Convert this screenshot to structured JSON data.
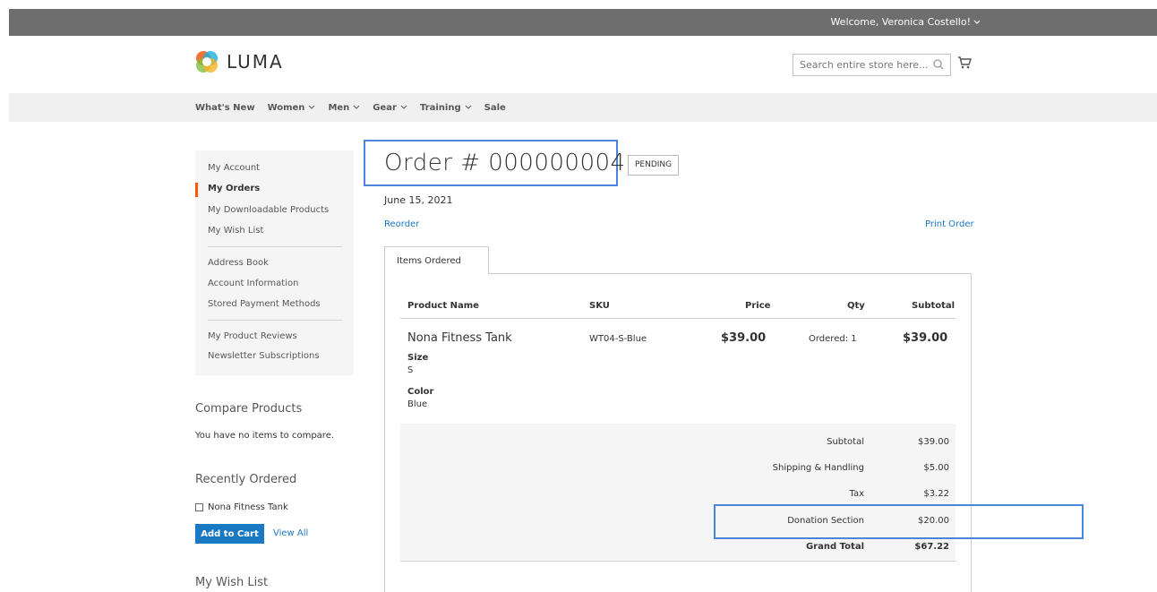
{
  "header": {
    "welcome": "Welcome, Veronica Costello!",
    "logo": "LUMA",
    "search_placeholder": "Search entire store here..."
  },
  "nav": [
    "What's New",
    "Women",
    "Men",
    "Gear",
    "Training",
    "Sale"
  ],
  "sidebar": {
    "group1": [
      "My Account",
      "My Orders",
      "My Downloadable Products",
      "My Wish List"
    ],
    "group2": [
      "Address Book",
      "Account Information",
      "Stored Payment Methods"
    ],
    "group3": [
      "My Product Reviews",
      "Newsletter Subscriptions"
    ]
  },
  "compare": {
    "title": "Compare Products",
    "text": "You have no items to compare."
  },
  "recent": {
    "title": "Recently Ordered",
    "item": "Nona Fitness Tank",
    "add_to_cart": "Add to Cart",
    "view_all": "View All"
  },
  "wishlist_title": "My Wish List",
  "order": {
    "title": "Order # 000000004",
    "status": "PENDING",
    "date": "June 15, 2021",
    "reorder": "Reorder",
    "print": "Print Order",
    "tab": "Items Ordered"
  },
  "table": {
    "headers": [
      "Product Name",
      "SKU",
      "Price",
      "Qty",
      "Subtotal"
    ],
    "row": {
      "name": "Nona Fitness Tank",
      "sku": "WT04-S-Blue",
      "price": "$39.00",
      "qty": "Ordered: 1",
      "subtotal": "$39.00",
      "options": [
        {
          "label": "Size",
          "value": "S"
        },
        {
          "label": "Color",
          "value": "Blue"
        }
      ]
    }
  },
  "totals": [
    {
      "label": "Subtotal",
      "value": "$39.00"
    },
    {
      "label": "Shipping & Handling",
      "value": "$5.00"
    },
    {
      "label": "Tax",
      "value": "$3.22"
    },
    {
      "label": "Donation Section",
      "value": "$20.00"
    },
    {
      "label": "Grand Total",
      "value": "$67.22"
    }
  ],
  "colors": {
    "accent": "#1979c3",
    "active": "#ff5501",
    "highlight": "#4a86d8"
  }
}
